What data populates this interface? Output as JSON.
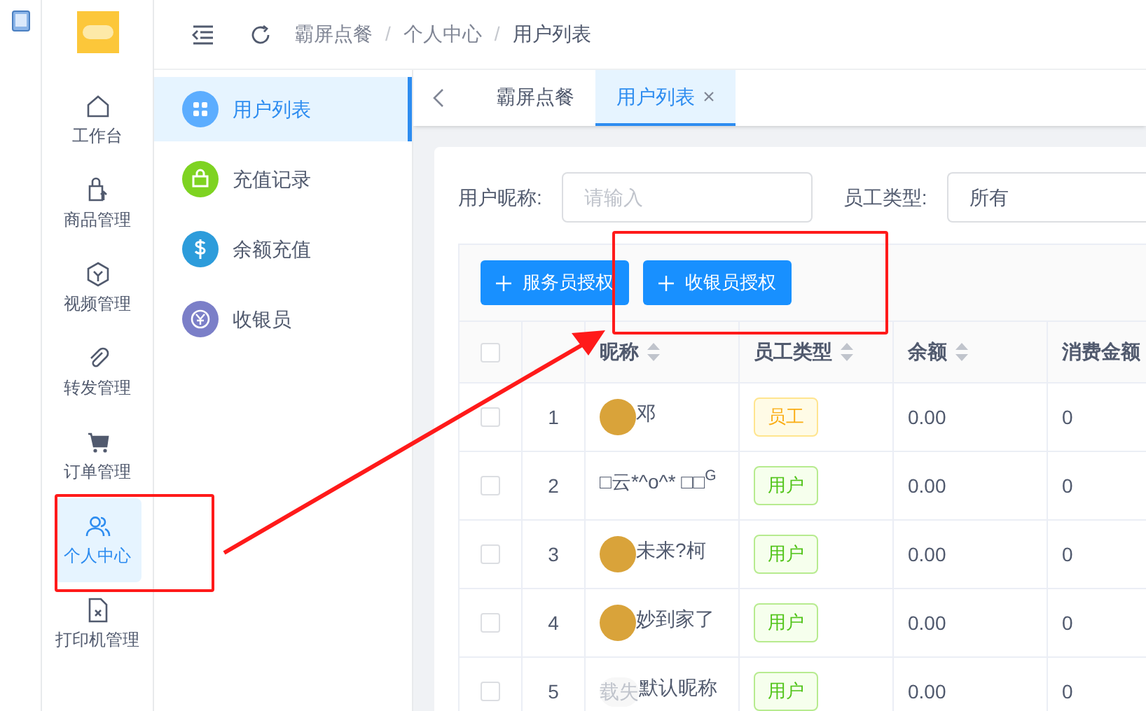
{
  "nav": {
    "items": [
      {
        "label": "工作台",
        "selected": false
      },
      {
        "label": "商品管理",
        "selected": false
      },
      {
        "label": "视频管理",
        "selected": false
      },
      {
        "label": "转发管理",
        "selected": false
      },
      {
        "label": "订单管理",
        "selected": false
      },
      {
        "label": "个人中心",
        "selected": true
      },
      {
        "label": "打印机管理",
        "selected": false
      }
    ]
  },
  "submenu": {
    "items": [
      {
        "label": "用户列表",
        "color": "#5cadff",
        "selected": true
      },
      {
        "label": "充值记录",
        "color": "#7ed321",
        "selected": false
      },
      {
        "label": "余额充值",
        "color": "#2d9cdb",
        "selected": false
      },
      {
        "label": "收银员",
        "color": "#7b7fc8",
        "selected": false
      }
    ]
  },
  "breadcrumb": [
    {
      "kind": "link",
      "text": "霸屏点餐"
    },
    {
      "kind": "separator",
      "text": "/"
    },
    {
      "kind": "link",
      "text": "个人中心"
    },
    {
      "kind": "separator",
      "text": "/"
    },
    {
      "kind": "current",
      "text": "用户列表"
    }
  ],
  "tabs": [
    {
      "label": "霸屏点餐",
      "selected": false,
      "closable": false
    },
    {
      "label": "用户列表",
      "selected": true,
      "closable": true
    }
  ],
  "filters": [
    {
      "label": "用户昵称:",
      "kind": "input",
      "placeholder": "请输入"
    },
    {
      "label": "员工类型:",
      "kind": "select",
      "value": "所有"
    }
  ],
  "buttons": [
    "服务员授权",
    "收银员授权"
  ],
  "table": {
    "all_checked": false,
    "columns": [
      "昵称",
      "员工类型",
      "余额",
      "消费金额"
    ],
    "rows": [
      {
        "index": "1",
        "avatar": true,
        "nickname": "邓",
        "type": "员工",
        "kind": "staff",
        "balance": "0.00",
        "spent": "0",
        "checked": false
      },
      {
        "index": "2",
        "avatar": false,
        "nickname": "□云*^o^* □□$^{G}$",
        "type": "用户",
        "kind": "user",
        "balance": "0.00",
        "spent": "0",
        "checked": false
      },
      {
        "index": "3",
        "avatar": true,
        "nickname": "未来?柯",
        "type": "用户",
        "kind": "user",
        "balance": "0.00",
        "spent": "0",
        "checked": false
      },
      {
        "index": "4",
        "avatar": true,
        "nickname": "妙到家了",
        "type": "用户",
        "kind": "user",
        "balance": "0.00",
        "spent": "0",
        "checked": false
      },
      {
        "index": "5",
        "avatar": true,
        "avatar_alt": "载失",
        "nickname": "默认昵称",
        "type": "用户",
        "kind": "user",
        "balance": "0.00",
        "spent": "0",
        "checked": false
      }
    ]
  }
}
